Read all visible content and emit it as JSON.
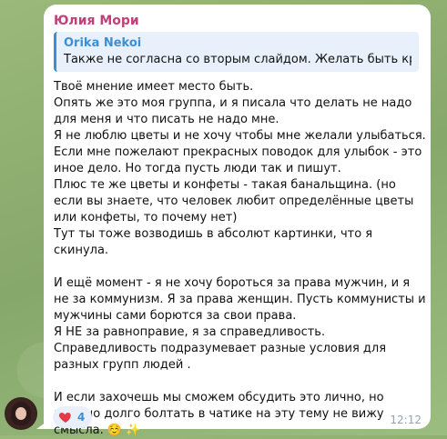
{
  "message": {
    "sender": "Юлия Мори",
    "reply": {
      "author": "Orika Nekoi",
      "text": "Также не согласна со вторым слайдом. Желать быть красивы..."
    },
    "paragraphs": [
      [
        "Твоё мнение имеет место быть.",
        "Опять же это моя группа, и я писала что делать не надо для меня и что писать не надо мне.",
        "Я не люблю цветы и не хочу чтобы мне желали улыбаться. Если мне пожелают прекрасных поводок для улыбок - это иное дело. Но тогда пусть люди так и пишут.",
        "Плюс те же цветы и конфеты - такая банальщина. (но если вы знаете, что человек любит определённые цветы или конфеты, то почему нет)",
        "Тут ты тоже возводишь в абсолют картинки, что я скинула."
      ],
      [
        "И ещё момент - я не хочу бороться за права мужчин, и я не за коммунизм. Я за права женщин. Пусть коммунисты и мужчины сами борются за свои права.",
        "Я НЕ за равноправие, я за справедливость.",
        "Справедливость подразумевает разные условия для разных групп людей ."
      ],
      [
        "И если захочешь мы сможем обсудить это лично, но именно долго болтать в чатике на эту тему не вижу смысла. ☺️ ✨"
      ]
    ],
    "reaction": {
      "emoji": "heart",
      "count": "4"
    },
    "time": "12:12"
  },
  "colors": {
    "sender": "#c2407a",
    "reply_accent": "#3b8fd6",
    "reaction_bg": "#e9f0fa",
    "heart": "#e53945"
  }
}
